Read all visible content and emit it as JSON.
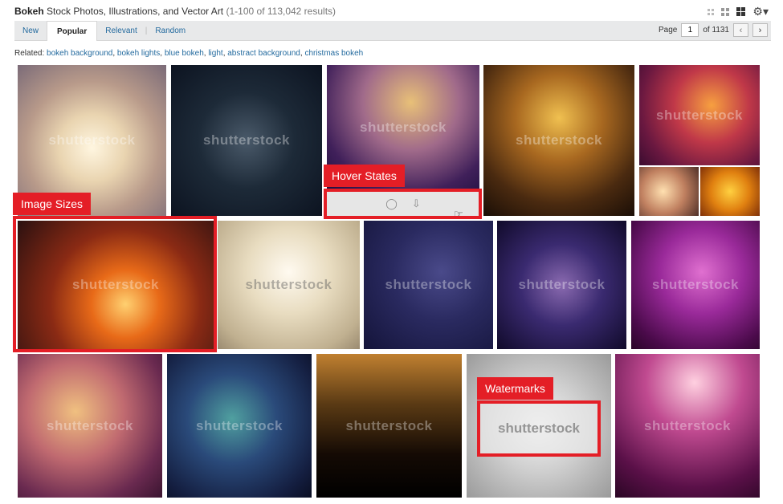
{
  "header": {
    "keyword": "Bokeh",
    "title": "Stock Photos, Illustrations, and Vector Art",
    "count": "(1-100 of 113,042 results)"
  },
  "view_icons": [
    "small-grid-icon",
    "medium-grid-icon",
    "large-grid-icon",
    "gear-icon"
  ],
  "tabs": [
    {
      "label": "New"
    },
    {
      "label": "Popular"
    },
    {
      "label": "Relevant"
    },
    {
      "label": "Random"
    }
  ],
  "pager": {
    "label": "Page",
    "value": "1",
    "of": "of 1131",
    "prev_icon": "chevron-left-icon",
    "next_icon": "chevron-right-icon"
  },
  "related": {
    "label": "Related:",
    "items": [
      "bokeh background",
      "bokeh lights",
      "blue bokeh",
      "light",
      "abstract background",
      "christmas bokeh"
    ]
  },
  "watermark": "shutterstock",
  "callouts": {
    "hover_states": "Hover States",
    "image_sizes": "Image Sizes",
    "watermarks": "Watermarks"
  },
  "hover_icons": [
    "lightbox-icon",
    "download-icon"
  ],
  "colors": {
    "accent": "#e41e26",
    "link": "#236a9e"
  }
}
